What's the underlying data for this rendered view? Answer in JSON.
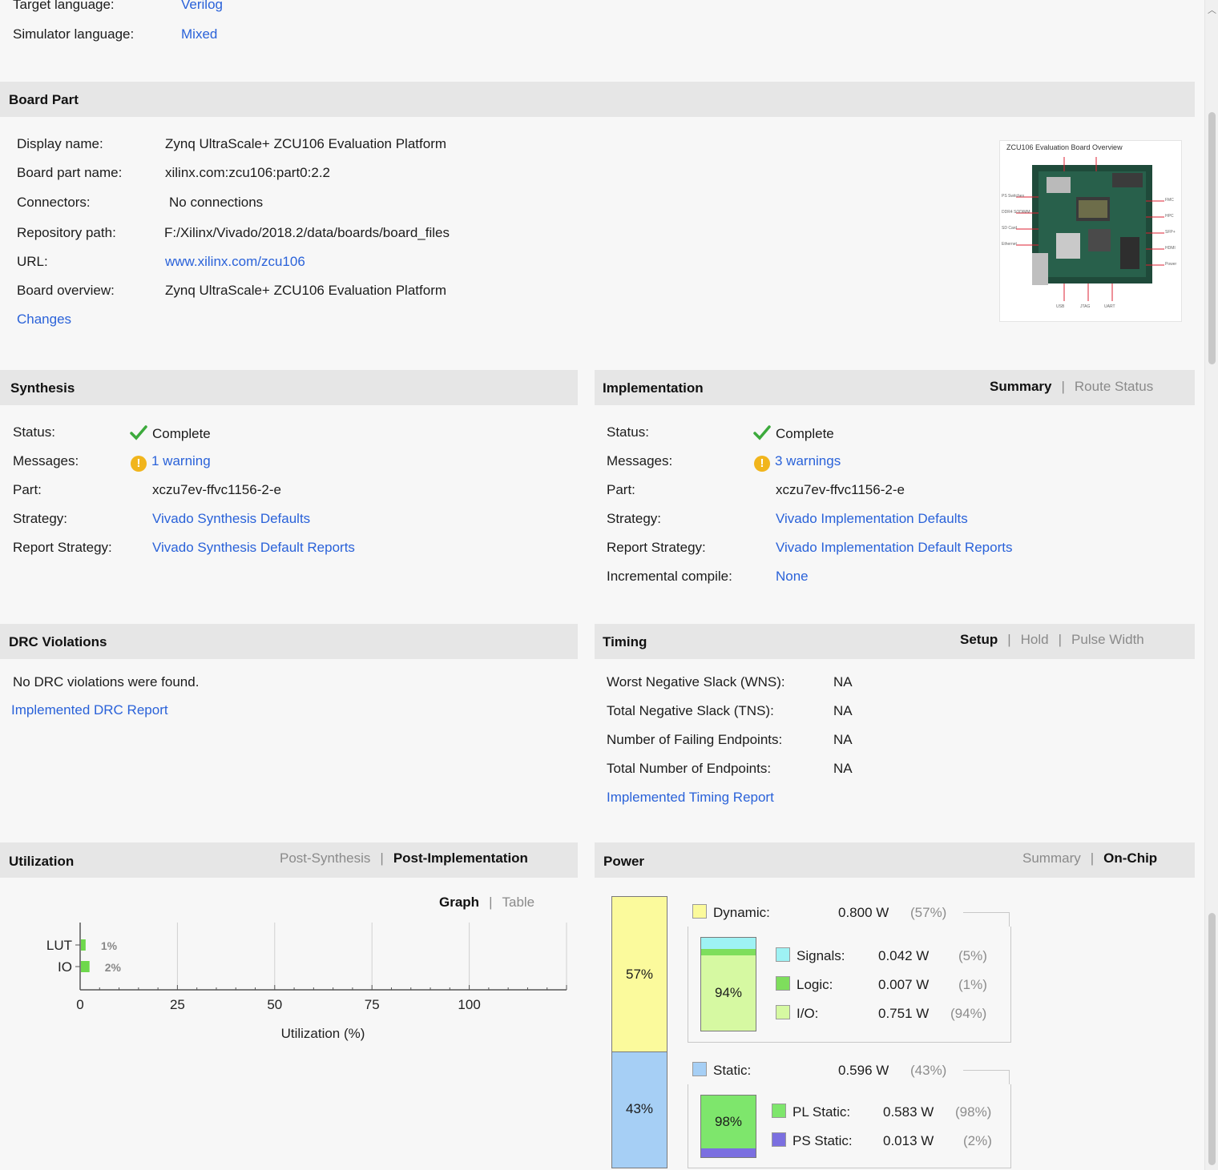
{
  "project": {
    "target_language_label": "Target language:",
    "target_language_value": "Verilog",
    "simulator_language_label": "Simulator language:",
    "simulator_language_value": "Mixed"
  },
  "board_part": {
    "title": "Board Part",
    "rows": [
      {
        "label": "Display name:",
        "value": "Zynq UltraScale+ ZCU106 Evaluation Platform"
      },
      {
        "label": "Board part name:",
        "value": "xilinx.com:zcu106:part0:2.2"
      },
      {
        "label": "Connectors:",
        "value": "No connections"
      },
      {
        "label": "Repository path:",
        "value": "F:/Xilinx/Vivado/2018.2/data/boards/board_files"
      },
      {
        "label": "URL:",
        "value": "www.xilinx.com/zcu106"
      },
      {
        "label": "Board overview:",
        "value": "Zynq UltraScale+ ZCU106 Evaluation Platform"
      }
    ],
    "changes_link": "Changes",
    "image_caption": "ZCU106 Evaluation Board Overview"
  },
  "synthesis": {
    "title": "Synthesis",
    "status_label": "Status:",
    "status_value": "Complete",
    "messages_label": "Messages:",
    "messages_value": "1 warning",
    "part_label": "Part:",
    "part_value": "xczu7ev-ffvc1156-2-e",
    "strategy_label": "Strategy:",
    "strategy_value": "Vivado Synthesis Defaults",
    "report_label": "Report Strategy:",
    "report_value": "Vivado Synthesis Default Reports"
  },
  "implementation": {
    "title": "Implementation",
    "tab_summary": "Summary",
    "tab_route": "Route Status",
    "status_label": "Status:",
    "status_value": "Complete",
    "messages_label": "Messages:",
    "messages_value": "3 warnings",
    "part_label": "Part:",
    "part_value": "xczu7ev-ffvc1156-2-e",
    "strategy_label": "Strategy:",
    "strategy_value": "Vivado Implementation Defaults",
    "report_label": "Report Strategy:",
    "report_value": "Vivado Implementation Default Reports",
    "incremental_label": "Incremental compile:",
    "incremental_value": "None"
  },
  "drc": {
    "title": "DRC Violations",
    "message": "No DRC violations were found.",
    "report_link": "Implemented DRC Report"
  },
  "timing": {
    "title": "Timing",
    "tab_setup": "Setup",
    "tab_hold": "Hold",
    "tab_pulse": "Pulse Width",
    "rows": [
      {
        "label": "Worst Negative Slack (WNS):",
        "value": "NA"
      },
      {
        "label": "Total Negative Slack (TNS):",
        "value": "NA"
      },
      {
        "label": "Number of Failing Endpoints:",
        "value": "NA"
      },
      {
        "label": "Total Number of Endpoints:",
        "value": "NA"
      }
    ],
    "report_link": "Implemented Timing Report"
  },
  "utilization": {
    "title": "Utilization",
    "tab_post_synth": "Post-Synthesis",
    "tab_post_impl": "Post-Implementation",
    "tab_graph": "Graph",
    "tab_table": "Table",
    "chart_data": {
      "type": "bar",
      "orientation": "horizontal",
      "categories": [
        "LUT",
        "IO"
      ],
      "values": [
        1,
        2
      ],
      "value_labels": [
        "1%",
        "2%"
      ],
      "xlabel": "Utilization (%)",
      "xlim": [
        0,
        125
      ],
      "xticks": [
        0,
        25,
        50,
        75,
        100
      ],
      "bar_color": "#6ed84c",
      "grid": true
    }
  },
  "power": {
    "title": "Power",
    "tab_summary": "Summary",
    "tab_onchip": "On-Chip",
    "dynamic": {
      "label": "Dynamic:",
      "value": "0.800 W",
      "pct": "(57%)",
      "share": 57,
      "color": "#fbfa9c"
    },
    "signals": {
      "label": "Signals:",
      "value": "0.042 W",
      "pct": "(5%)",
      "share": 5,
      "color": "#9ef2f4"
    },
    "logic": {
      "label": "Logic:",
      "value": "0.007 W",
      "pct": "(1%)",
      "share": 1,
      "color": "#7ede5c"
    },
    "io": {
      "label": "I/O:",
      "value": "0.751 W",
      "pct": "(94%)",
      "share": 94,
      "color": "#d6f9a2"
    },
    "static": {
      "label": "Static:",
      "value": "0.596 W",
      "pct": "(43%)",
      "share": 43,
      "color": "#a6cff5"
    },
    "pl_static": {
      "label": "PL Static:",
      "value": "0.583 W",
      "pct": "(98%)",
      "share": 98,
      "color": "#7ee66c"
    },
    "ps_static": {
      "label": "PS Static:",
      "value": "0.013 W",
      "pct": "(2%)",
      "share": 2,
      "color": "#7b6fe0"
    },
    "bar_dynamic_label": "57%",
    "bar_static_label": "43%",
    "dynamic_inner_label": "94%",
    "static_inner_label": "98%"
  }
}
